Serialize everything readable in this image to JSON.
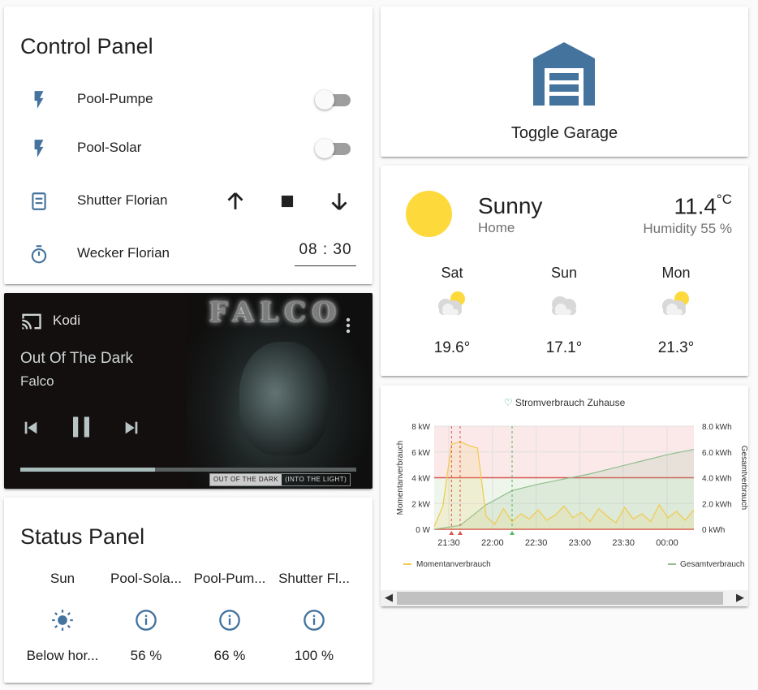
{
  "control_panel": {
    "title": "Control Panel",
    "rows": [
      {
        "label": "Pool-Pumpe",
        "icon": "flash-icon",
        "type": "toggle",
        "state": "off"
      },
      {
        "label": "Pool-Solar",
        "icon": "flash-icon",
        "type": "toggle",
        "state": "off"
      },
      {
        "label": "Shutter Florian",
        "icon": "window-shutter-icon",
        "type": "cover"
      },
      {
        "label": "Wecker Florian",
        "icon": "timer-icon",
        "type": "time",
        "value": "08 : 30"
      }
    ]
  },
  "media": {
    "source": "Kodi",
    "title": "Out Of The Dark",
    "artist": "Falco",
    "album_art_text": "FALCO",
    "album_label_a": "OUT OF THE DARK",
    "album_label_b": "(INTO THE LIGHT)",
    "progress": 0.4
  },
  "status_panel": {
    "title": "Status Panel",
    "badges": [
      {
        "name": "Sun",
        "icon": "sun-icon",
        "value": "Below hor..."
      },
      {
        "name": "Pool-Sola...",
        "icon": "info-icon",
        "value": "56 %"
      },
      {
        "name": "Pool-Pum...",
        "icon": "info-icon",
        "value": "66 %"
      },
      {
        "name": "Shutter Fl...",
        "icon": "info-icon",
        "value": "100 %"
      }
    ]
  },
  "garage": {
    "label": "Toggle Garage",
    "icon": "garage-icon"
  },
  "weather": {
    "condition": "Sunny",
    "location": "Home",
    "temperature": "11.4",
    "unit": "°C",
    "humidity": "Humidity 55 %",
    "forecast": [
      {
        "day": "Sat",
        "temp": "19.6°",
        "icon": "partly-cloudy-icon"
      },
      {
        "day": "Sun",
        "temp": "17.1°",
        "icon": "cloudy-icon"
      },
      {
        "day": "Mon",
        "temp": "21.3°",
        "icon": "partly-cloudy-icon"
      }
    ]
  },
  "chart_data": {
    "type": "line",
    "title": "Stromverbrauch Zuhause",
    "xlabel": "",
    "ylabel": "Momentanverbrauch",
    "y2label": "Gesamtverbrauch",
    "x_ticks": [
      "21:30",
      "22:00",
      "22:30",
      "23:00",
      "23:30",
      "00:00"
    ],
    "y_ticks": [
      "0 W",
      "2 kW",
      "4 kW",
      "6 kW",
      "8 kW"
    ],
    "y2_ticks": [
      "0 kWh",
      "2.0 kWh",
      "4.0 kWh",
      "6.0 kWh",
      "8.0 kWh"
    ],
    "ylim": [
      0,
      8
    ],
    "y2lim": [
      0,
      8
    ],
    "threshold": 4,
    "series": [
      {
        "name": "Momentanverbrauch",
        "color": "#f2c94c",
        "x": [
          21.0,
          21.1,
          21.2,
          21.3,
          21.4,
          21.5,
          21.6,
          21.7,
          21.8,
          21.9,
          22.0,
          22.1,
          22.2,
          22.3,
          22.4,
          22.5,
          22.6,
          22.7,
          22.8,
          22.9,
          23.0,
          23.1,
          23.2,
          23.3,
          23.4,
          23.5,
          23.6,
          23.7,
          23.8,
          23.9,
          24.0
        ],
        "values": [
          0.2,
          1.8,
          6.6,
          6.8,
          6.5,
          6.3,
          1.0,
          0.4,
          1.6,
          0.6,
          1.2,
          0.8,
          1.5,
          0.7,
          1.1,
          1.8,
          0.9,
          1.3,
          0.6,
          1.6,
          1.0,
          0.5,
          1.7,
          0.8,
          1.2,
          0.6,
          1.9,
          0.9,
          1.4,
          0.7,
          1.5
        ]
      },
      {
        "name": "Gesamtverbrauch",
        "color": "#8fbf8f",
        "x": [
          21.0,
          21.3,
          21.6,
          21.9,
          22.2,
          22.5,
          22.8,
          23.1,
          23.4,
          23.7,
          24.0
        ],
        "values": [
          0.0,
          0.3,
          1.9,
          3.0,
          3.5,
          3.9,
          4.3,
          4.8,
          5.3,
          5.8,
          6.2
        ]
      }
    ]
  }
}
